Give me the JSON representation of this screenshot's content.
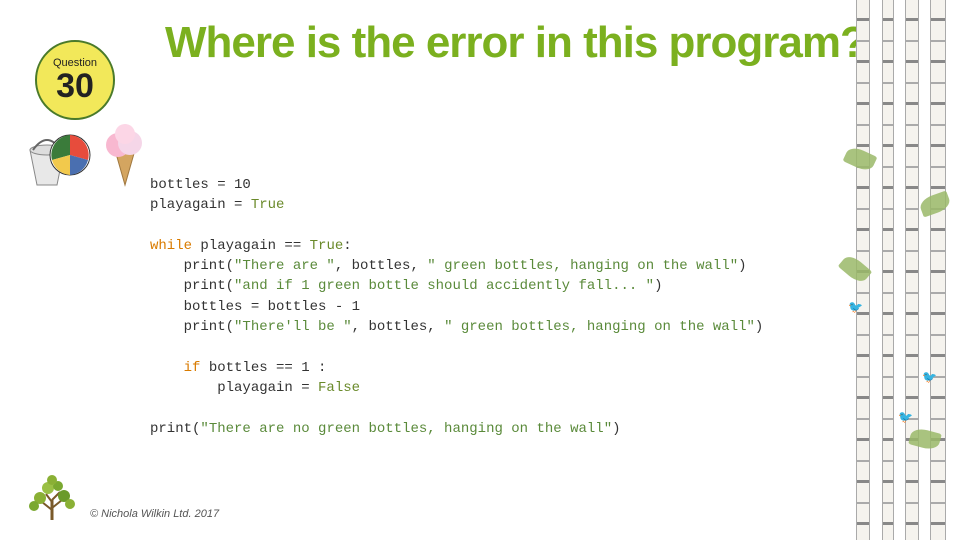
{
  "question": {
    "label": "Question",
    "number": "30"
  },
  "title": "Where is the error in this program?",
  "code": {
    "l1a": "bottles = 10",
    "l2a": "playagain = ",
    "l2b": "True",
    "l3a": "while",
    "l3b": " playagain == ",
    "l3c": "True",
    "l3d": ":",
    "l4a": "    print(",
    "l4b": "\"There are \"",
    "l4c": ", bottles, ",
    "l4d": "\" green bottles, hanging on the wall\"",
    "l4e": ")",
    "l5a": "    print(",
    "l5b": "\"and if 1 green bottle should accidently fall... \"",
    "l5c": ")",
    "l6a": "    bottles = bottles - 1",
    "l7a": "    print(",
    "l7b": "\"There'll be \"",
    "l7c": ", bottles, ",
    "l7d": "\" green bottles, hanging on the wall\"",
    "l7e": ")",
    "l8a": "    ",
    "l8b": "if",
    "l8c": " bottles == 1 :",
    "l9a": "        playagain = ",
    "l9b": "False",
    "l10a": "print(",
    "l10b": "\"There are no green bottles, hanging on the wall\"",
    "l10c": ")"
  },
  "copyright": "© Nichola Wilkin Ltd. 2017"
}
